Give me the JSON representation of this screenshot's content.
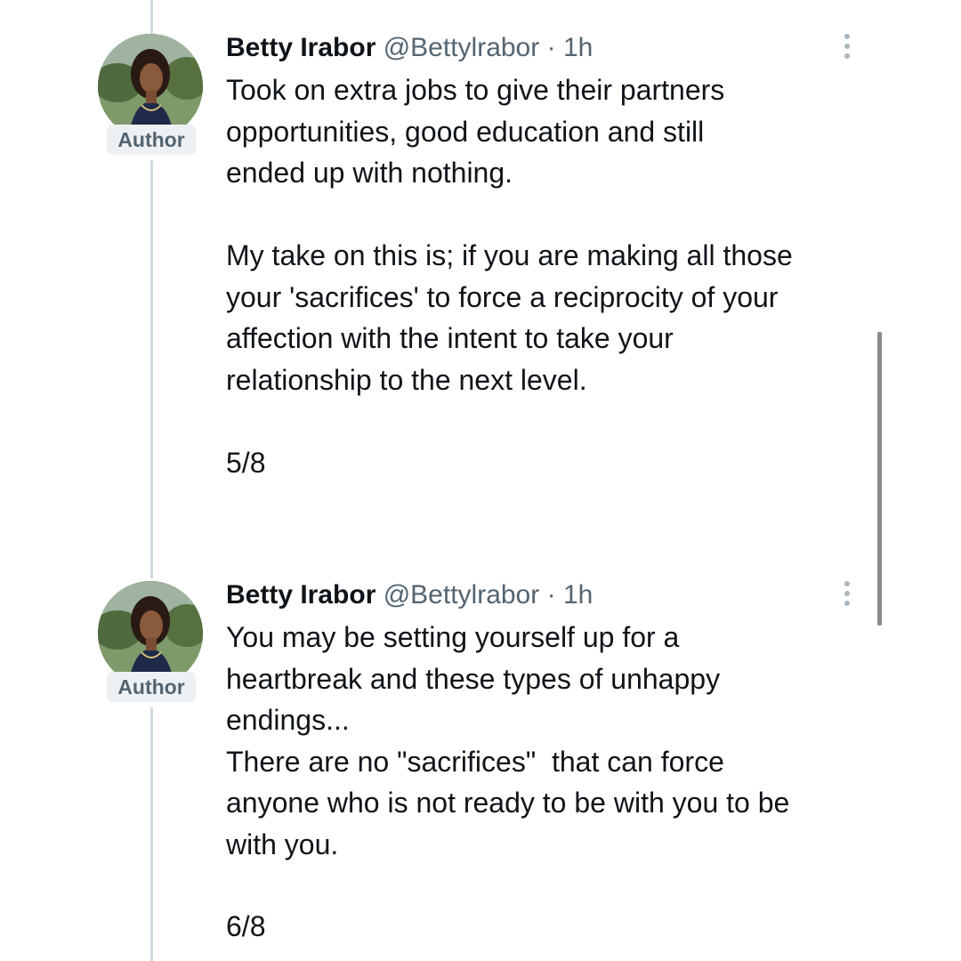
{
  "tweets": [
    {
      "author_name": "Betty Irabor",
      "handle": "@Bettylrabor",
      "separator": "·",
      "time": "1h",
      "badge": "Author",
      "text": "Took on extra jobs to give their partners\nopportunities, good education and still\nended up with nothing.\n\nMy take on this is; if you are making all those\nyour 'sacrifices' to force a reciprocity of your\naffection with the intent to take your\nrelationship to the next level.",
      "counter": "5/8"
    },
    {
      "author_name": "Betty Irabor",
      "handle": "@Bettylrabor",
      "separator": "·",
      "time": "1h",
      "badge": "Author",
      "text": "You may be setting yourself up for a\nheartbreak and these types of unhappy\nendings...\nThere are no \"sacrifices\"  that can force\nanyone who is not ready to be with you to be\nwith you.",
      "counter": "6/8"
    }
  ],
  "colors": {
    "thread_line": "#cfd9de",
    "secondary_text": "#536471",
    "primary_text": "#0f1419",
    "badge_bg": "#eef1f4"
  }
}
